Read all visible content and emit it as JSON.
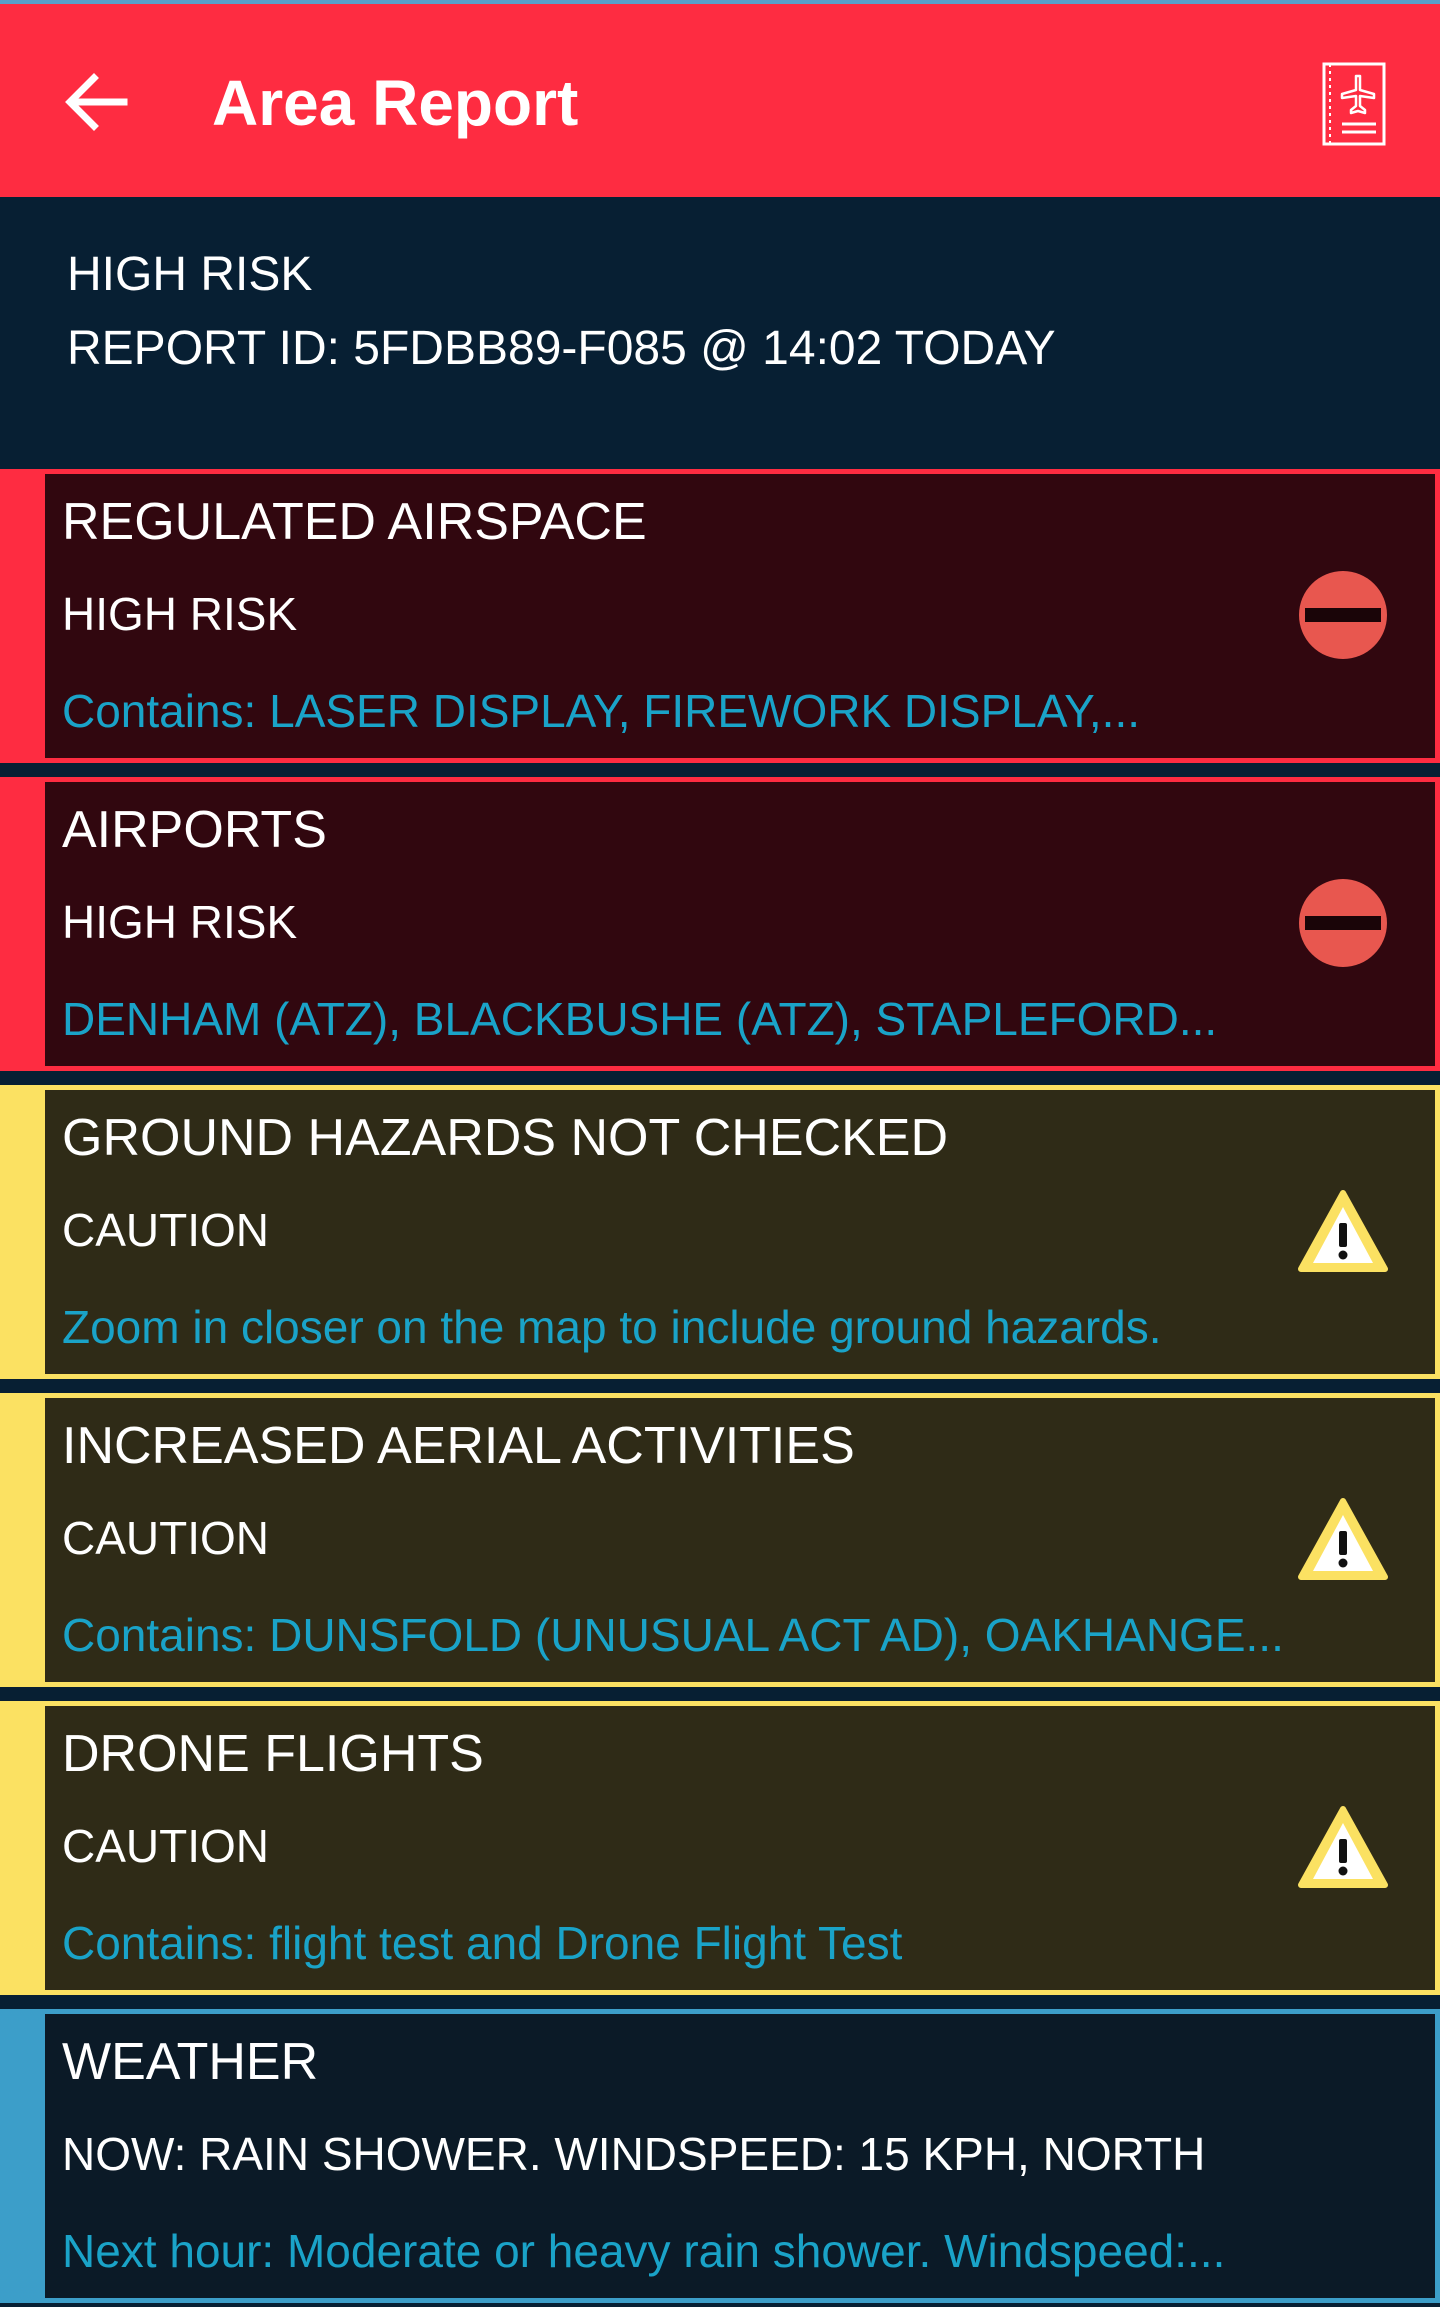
{
  "app_bar": {
    "title": "Area Report",
    "back_icon": "arrow-left-icon",
    "logbook_icon": "flight-logbook-icon",
    "color": "#fe2c41"
  },
  "summary": {
    "risk": "HIGH RISK",
    "report_line": "REPORT ID: 5FDBB89-F085 @ 14:02 TODAY"
  },
  "cards": [
    {
      "title": "REGULATED AIRSPACE",
      "level": "HIGH RISK",
      "detail": "Contains: LASER DISPLAY, FIREWORK DISPLAY,...",
      "severity": "high",
      "icon": "no-entry-icon"
    },
    {
      "title": "AIRPORTS",
      "level": "HIGH RISK",
      "detail": "DENHAM (ATZ), BLACKBUSHE (ATZ), STAPLEFORD...",
      "severity": "high",
      "icon": "no-entry-icon"
    },
    {
      "title": "GROUND HAZARDS NOT CHECKED",
      "level": "CAUTION",
      "detail": "Zoom in closer on the map to include ground hazards.",
      "severity": "caution",
      "icon": "warning-icon"
    },
    {
      "title": "INCREASED AERIAL ACTIVITIES",
      "level": "CAUTION",
      "detail": "Contains: DUNSFOLD (UNUSUAL ACT AD), OAKHANGE...",
      "severity": "caution",
      "icon": "warning-icon"
    },
    {
      "title": "DRONE FLIGHTS",
      "level": "CAUTION",
      "detail": "Contains: flight test and Drone Flight Test",
      "severity": "caution",
      "icon": "warning-icon"
    },
    {
      "title": "WEATHER",
      "level": "NOW: RAIN SHOWER. WINDSPEED: 15 KPH, NORTH",
      "detail": "Next hour: Moderate or heavy rain shower. Windspeed:...",
      "severity": "info",
      "icon": ""
    }
  ],
  "colors": {
    "high": "#fe2c41",
    "caution": "#fbe162",
    "info": "#3c9ec9",
    "detail_text": "#1aa3c8",
    "background": "#071f33"
  }
}
